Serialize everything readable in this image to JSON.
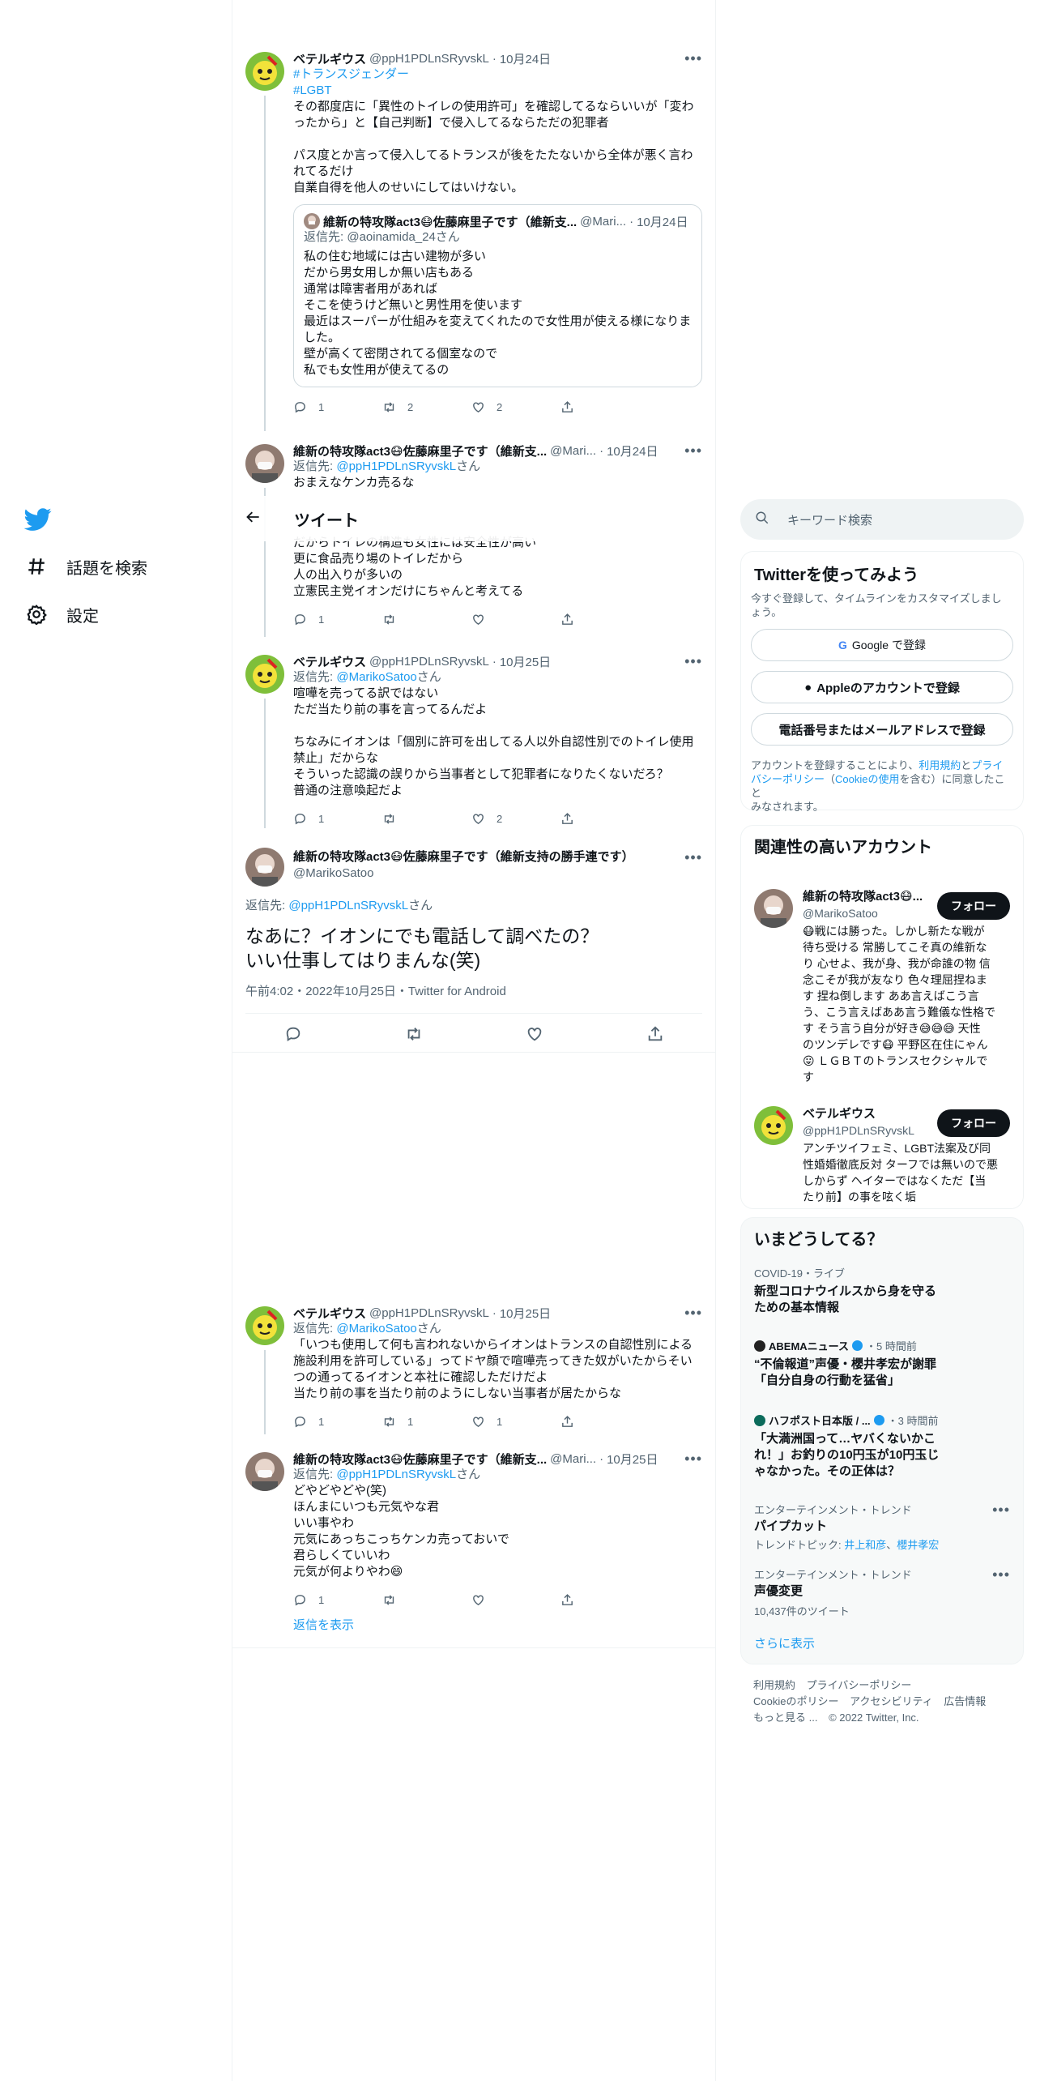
{
  "nav": {
    "explore": "話題を検索",
    "settings": "設定"
  },
  "header": {
    "title": "ツイート"
  },
  "tweets": [
    {
      "name": "ベテルギウス",
      "handle": "@ppH1PDLnSRyvskL",
      "date": "10月24日",
      "hashtag1": "#トランスジェンダー",
      "hashtag2": "#LGBT",
      "lines": [
        "その都度店に「異性のトイレの使用許可」を確認してるならいいが「変わ",
        "ったから」と【自己判断】で侵入してるならただの犯罪者",
        "",
        "パス度とか言って侵入してるトランスが後をたたないから全体が悪く言わ",
        "れてるだけ",
        "自業自得を他人のせいにしてはいけない。"
      ],
      "quote": {
        "name": "維新の特攻隊act3😷佐藤麻里子です（維新支...",
        "handle": "@Mari...",
        "date": "10月24日",
        "reply_prefix": "返信先: ",
        "reply_to": "@aoinamida_24さん",
        "lines": [
          "私の住む地域には古い建物が多い",
          "だから男女用しか無い店もある",
          "通常は障害者用があれば",
          "そこを使うけど無いと男性用を使います",
          "最近はスーパーが仕組みを変えてくれたので女性用が使える様になりま",
          "した。",
          "壁が高くて密閉されてる個室なので",
          "私でも女性用が使えてるの"
        ]
      },
      "replies": "1",
      "retweets": "2",
      "likes": "2"
    },
    {
      "name": "維新の特攻隊act3😷佐藤麻里子です（維新支...",
      "handle": "@Mari...",
      "date": "10月24日",
      "reply_prefix": "返信先: ",
      "reply_to": "@ppH1PDLnSRyvskL",
      "reply_suffix": "さん",
      "first_line": "おまえなケンカ売るな",
      "lines": [
        "だからトイレの構造も女性には安全性が高い",
        "更に食品売り場のトイレだから",
        "人の出入りが多いの",
        "立憲民主党イオンだけにちゃんと考えてる"
      ],
      "replies": "1",
      "retweets": "",
      "likes": ""
    },
    {
      "name": "ベテルギウス",
      "handle": "@ppH1PDLnSRyvskL",
      "date": "10月25日",
      "reply_prefix": "返信先: ",
      "reply_to": "@MarikoSatoo",
      "reply_suffix": "さん",
      "lines": [
        "喧嘩を売ってる訳ではない",
        "ただ当たり前の事を言ってるんだよ",
        "",
        "ちなみにイオンは「個別に許可を出してる人以外自認性別でのトイレ使用",
        "禁止」だからな",
        "そういった認識の誤りから当事者として犯罪者になりたくないだろ？",
        "普通の注意喚起だよ"
      ],
      "replies": "1",
      "retweets": "",
      "likes": "2"
    },
    {
      "name": "ベテルギウス",
      "handle": "@ppH1PDLnSRyvskL",
      "date": "10月25日",
      "reply_prefix": "返信先: ",
      "reply_to": "@MarikoSatoo",
      "reply_suffix": "さん",
      "lines": [
        "「いつも使用して何も言われないからイオンはトランスの自認性別による",
        "施設利用を許可している」ってドヤ顔で喧嘩売ってきた奴がいたからそい",
        "つの通ってるイオンと本社に確認しただけだよ",
        "当たり前の事を当たり前のようにしない当事者が居たからな"
      ],
      "replies": "1",
      "retweets": "1",
      "likes": "1"
    },
    {
      "name": "維新の特攻隊act3😷佐藤麻里子です（維新支...",
      "handle": "@Mari...",
      "date": "10月25日",
      "reply_prefix": "返信先: ",
      "reply_to": "@ppH1PDLnSRyvskL",
      "reply_suffix": "さん",
      "lines": [
        "どやどやどや(笑)",
        "ほんまにいつも元気やな君",
        "いい事やわ",
        "元気にあっちこっちケンカ売っておいで",
        "君らしくていいわ",
        "元気が何よりやわ😄"
      ],
      "replies": "1",
      "retweets": "",
      "likes": "",
      "show_replies": "返信を表示"
    }
  ],
  "main_tweet": {
    "name": "維新の特攻隊act3😷佐藤麻里子です（維新支持の勝手連です）",
    "handle": "@MarikoSatoo",
    "reply_prefix": "返信先: ",
    "reply_to": "@ppH1PDLnSRyvskL",
    "reply_suffix": "さん",
    "line1": "なあに？イオンにでも電話して調べたの？",
    "line2": "いい仕事してはりまんな(笑)",
    "meta": "午前4:02・2022年10月25日・Twitter for Android"
  },
  "right": {
    "search_placeholder": "キーワード検索",
    "signup": {
      "title": "Twitterを使ってみよう",
      "subtitle_1": "今すぐ登録して、タイムラインをカスタマイズしまし",
      "subtitle_2": "ょう。",
      "google": "Google で登録",
      "apple": "Appleのアカウントで登録",
      "phone": "電話番号またはメールアドレスで登録",
      "terms_1a": "アカウントを登録することにより、",
      "terms_1b": "利用規約",
      "terms_1c": "と",
      "terms_1d": "プライ",
      "terms_2a": "バシーポリシー",
      "terms_2b": "（",
      "terms_2c": "Cookieの使用",
      "terms_2d": "を含む）に同意したこと",
      "terms_3": "みなされます。"
    },
    "related": {
      "title": "関連性の高いアカウント",
      "follow": "フォロー",
      "accounts": [
        {
          "name": "維新の特攻隊act3😷...",
          "handle": "@MarikoSatoo",
          "bio": [
            "😷戦には勝った。しかし新たな戦が",
            "待ち受ける 常勝してこそ真の維新な",
            "り 心せよ、我が身、我が命誰の物 信",
            "念こそが我が友なり 色々理屈捏ねま",
            "す 捏ね倒します ああ言えばこう言",
            "う、こう言えばああ言う難儀な性格で",
            "す そう言う自分が好き😅😅😅 天性",
            "のツンデレです😷 平野区在住にゃん",
            "😛 ＬＧＢＴのトランスセクシャルで",
            "す"
          ]
        },
        {
          "name": "ベテルギウス",
          "handle": "@ppH1PDLnSRyvskL",
          "bio": [
            "アンチツイフェミ、LGBT法案及び同",
            "性婚婚徹底反対 ターフでは無いので悪",
            "しからず ヘイターではなくただ【当",
            "たり前】の事を呟く垢"
          ]
        }
      ]
    },
    "trends": {
      "title": "いまどうしてる？",
      "items": [
        {
          "category": "COVID-19・ライブ",
          "title_1": "新型コロナウイルスから身を守る",
          "title_2": "ための基本情報"
        },
        {
          "source": "ABEMAニュース",
          "time": "・5 時間前",
          "title_1": "“不倫報道”声優・櫻井孝宏が謝罪",
          "title_2": "「自分自身の行動を猛省」"
        },
        {
          "source": "ハフポスト日本版 / ...",
          "time": "・3 時間前",
          "title_1": "「大満洲国って…ヤバくないかこ",
          "title_2": "れ！」お釣りの10円玉が10円玉じ",
          "title_3": "ゃなかった。その正体は？"
        },
        {
          "category": "エンターテインメント・トレンド",
          "title_1": "パイプカット",
          "topic_label": "トレンドトピック: ",
          "topic_1": "井上和彦",
          "topic_sep": "、",
          "topic_2": "櫻井孝宏"
        },
        {
          "category": "エンターテインメント・トレンド",
          "title_1": "声優変更",
          "count": "10,437件のツイート"
        }
      ],
      "show_more": "さらに表示"
    },
    "footer": {
      "terms": "利用規約",
      "privacy": "プライバシーポリシー",
      "cookie": "Cookieのポリシー",
      "accessibility": "アクセシビリティ",
      "ads": "広告情報",
      "more": "もっと見る ...",
      "copyright": "© 2022 Twitter, Inc."
    }
  },
  "colors": {
    "accent": "#1d9bf0",
    "text": "#0f1419",
    "muted": "#536471",
    "border": "#eff3f4"
  }
}
